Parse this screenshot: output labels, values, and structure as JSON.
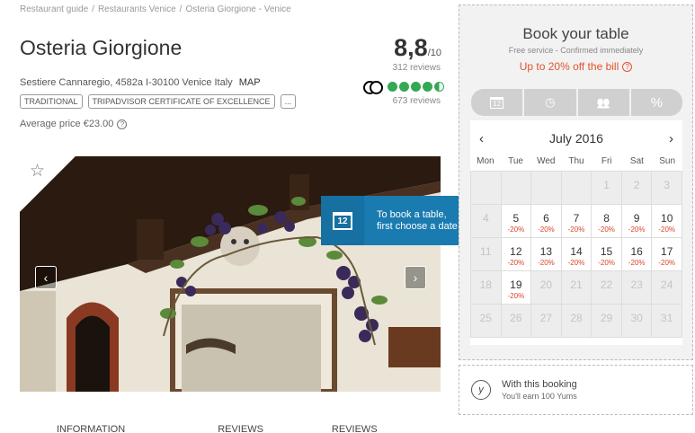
{
  "breadcrumb": [
    "Restaurant guide",
    "Restaurants Venice",
    "Osteria Giorgione - Venice"
  ],
  "restaurant": {
    "name": "Osteria Giorgione",
    "rating": "8,8",
    "rating_out_of": "/10",
    "rating_reviews": "312 reviews",
    "address": "Sestiere Cannaregio, 4582a I-30100 Venice Italy",
    "map_label": "MAP",
    "tags": [
      "TRADITIONAL",
      "TRIPADVISOR CERTIFICATE OF EXCELLENCE",
      "..."
    ],
    "avg_price": "Average price €23.00",
    "tripadvisor_bubbles": 4.5,
    "tripadvisor_reviews": "673 reviews"
  },
  "photo": {
    "prev_icon": "chevron-left-icon",
    "next_icon": "chevron-right-icon"
  },
  "tooltip": {
    "icon_text": "12",
    "line1": "To book a table,",
    "line2": "first choose a date"
  },
  "tabs": [
    "INFORMATION",
    "REVIEWS",
    "REVIEWS TRIPADVISOR"
  ],
  "booking": {
    "title": "Book your table",
    "subtitle": "Free service - Confirmed immediately",
    "offer": "Up to 20% off the bill",
    "steps": [
      {
        "icon": "calendar-icon",
        "glyph": "12"
      },
      {
        "icon": "clock-icon",
        "glyph": "◷"
      },
      {
        "icon": "people-icon",
        "glyph": "👥"
      },
      {
        "icon": "percent-icon",
        "glyph": "%"
      }
    ],
    "calendar": {
      "month": "July 2016",
      "weekdays": [
        "Mon",
        "Tue",
        "Wed",
        "Thu",
        "Fri",
        "Sat",
        "Sun"
      ],
      "weeks": [
        [
          {
            "d": "",
            "off": true
          },
          {
            "d": "",
            "off": true
          },
          {
            "d": "",
            "off": true
          },
          {
            "d": "",
            "off": true
          },
          {
            "d": "1",
            "off": true
          },
          {
            "d": "2",
            "off": true
          },
          {
            "d": "3",
            "off": true
          }
        ],
        [
          {
            "d": "4",
            "off": true
          },
          {
            "d": "5",
            "p": "-20%"
          },
          {
            "d": "6",
            "p": "-20%"
          },
          {
            "d": "7",
            "p": "-20%"
          },
          {
            "d": "8",
            "p": "-20%"
          },
          {
            "d": "9",
            "p": "-20%"
          },
          {
            "d": "10",
            "p": "-20%"
          }
        ],
        [
          {
            "d": "11",
            "off": true
          },
          {
            "d": "12",
            "p": "-20%"
          },
          {
            "d": "13",
            "p": "-20%"
          },
          {
            "d": "14",
            "p": "-20%"
          },
          {
            "d": "15",
            "p": "-20%"
          },
          {
            "d": "16",
            "p": "-20%"
          },
          {
            "d": "17",
            "p": "-20%"
          }
        ],
        [
          {
            "d": "18",
            "off": true
          },
          {
            "d": "19",
            "p": "-20%"
          },
          {
            "d": "20",
            "off": true
          },
          {
            "d": "21",
            "off": true
          },
          {
            "d": "22",
            "off": true
          },
          {
            "d": "23",
            "off": true
          },
          {
            "d": "24",
            "off": true
          }
        ],
        [
          {
            "d": "25",
            "off": true
          },
          {
            "d": "26",
            "off": true
          },
          {
            "d": "27",
            "off": true
          },
          {
            "d": "28",
            "off": true
          },
          {
            "d": "29",
            "off": true
          },
          {
            "d": "30",
            "off": true
          },
          {
            "d": "31",
            "off": true
          }
        ]
      ]
    }
  },
  "yums": {
    "icon_letter": "y",
    "line1": "With this booking",
    "line2": "You'll earn 100 Yums"
  },
  "colors": {
    "accent_orange": "#e0542e",
    "tooltip_blue": "#1a7bb0",
    "tripadvisor_green": "#34a853"
  }
}
